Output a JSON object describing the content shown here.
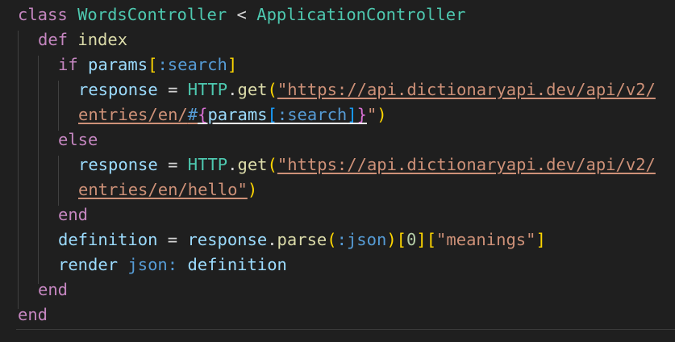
{
  "code": {
    "l1": {
      "kw_class": "class",
      "class_name": "WordsController",
      "op_lt": "<",
      "parent": "ApplicationController"
    },
    "l2": {
      "kw_def": "def",
      "method": "index"
    },
    "l3": {
      "kw_if": "if",
      "params": "params",
      "b_open": "[",
      "symbol": ":search",
      "b_close": "]"
    },
    "l4": {
      "var": "response",
      "op_eq": "=",
      "http": "HTTP",
      "dot": ".",
      "get": "get",
      "p_open": "(",
      "str": "\"https://api.dictionaryapi.dev/api/v2/"
    },
    "l5": {
      "str_a": "entries/en/",
      "hash": "#",
      "c_open": "{",
      "params": "params",
      "b_open": "[",
      "symbol": ":search",
      "b_close": "]",
      "c_close": "}",
      "quote": "\"",
      "p_close": ")"
    },
    "l6": {
      "kw_else": "else"
    },
    "l7": {
      "var": "response",
      "op_eq": "=",
      "http": "HTTP",
      "dot": ".",
      "get": "get",
      "p_open": "(",
      "str": "\"https://api.dictionaryapi.dev/api/v2/"
    },
    "l8": {
      "str": "entries/en/hello\"",
      "p_close": ")"
    },
    "l9": {
      "kw_end": "end"
    },
    "l10": {
      "var": "definition",
      "op_eq": "=",
      "recv": "response",
      "dot": ".",
      "method": "parse",
      "p_open": "(",
      "symbol": ":json",
      "p_close": ")",
      "b1_open": "[",
      "index": "0",
      "b1_close": "]",
      "b2_open": "[",
      "key": "\"meanings\"",
      "b2_close": "]"
    },
    "l11": {
      "render": "render",
      "json_key": "json:",
      "arg": "definition"
    },
    "l12": {
      "kw_end": "end"
    },
    "l13": {
      "kw_end": "end"
    }
  }
}
